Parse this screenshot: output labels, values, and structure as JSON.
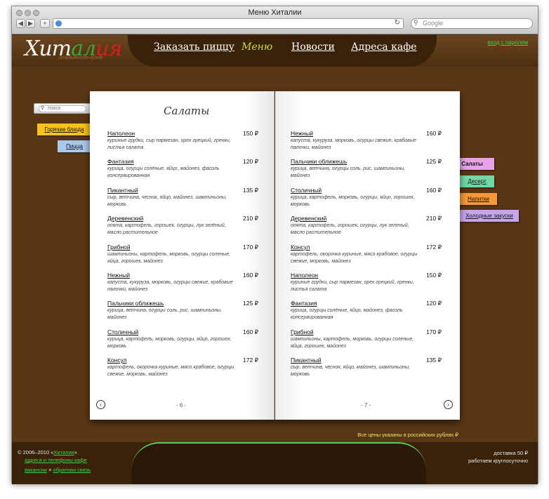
{
  "browser": {
    "title": "Меню Хиталии",
    "search_placeholder": "Google"
  },
  "header": {
    "logo": {
      "part1": "Хит",
      "part2": "ал",
      "part3": "ия"
    },
    "tagline": "итальянская кухня",
    "nav": [
      {
        "label": "Заказать пиццу"
      },
      {
        "label": "Меню"
      },
      {
        "label": "Новости"
      },
      {
        "label": "Адреса кафе"
      }
    ],
    "login": "вход с паролем"
  },
  "search": {
    "placeholder": "поиск"
  },
  "left_tabs": [
    {
      "label": "Горячие блюда",
      "color": "#f7c21c"
    },
    {
      "label": "Пицца",
      "color": "#a9c8ee"
    }
  ],
  "right_tabs": [
    {
      "label": "Салаты",
      "color": "#e6a3e8"
    },
    {
      "label": "Десерт",
      "color": "#6ed8a6"
    },
    {
      "label": "Напитки",
      "color": "#f59a3a"
    },
    {
      "label": "Холодные закуски",
      "color": "#c8a6ee"
    }
  ],
  "book": {
    "title": "Салаты",
    "left_page_number": "- 6 -",
    "right_page_number": "- 7 -",
    "left_items": [
      {
        "name": "Наполеон",
        "price": "150 ₽",
        "desc": "куриные грудки, сыр пармезан, орех грецкий, гренки, листья салата"
      },
      {
        "name": "Фантазия",
        "price": "120 ₽",
        "desc": "курица, огурцы солёные, яйцо, майонез, фасоль консервированная"
      },
      {
        "name": "Пикантный",
        "price": "135 ₽",
        "desc": "сыр, ветчина, чеснок, яйцо, майонез, шампиньоны, морковь"
      },
      {
        "name": "Деревенский",
        "price": "210 ₽",
        "desc": "опята, картофель, горошек, огурцы, лук зелёный, масло растительное"
      },
      {
        "name": "Грибной",
        "price": "170 ₽",
        "desc": "шампиньоны, картофель, морковь, огурцы соленые, яйца, горошек, майонез"
      },
      {
        "name": "Нежный",
        "price": "160 ₽",
        "desc": "капуста, кукуруза, морковь, огурцы свежие, крабовые палочки, майонез"
      },
      {
        "name": "Пальчики оближешь",
        "price": "125 ₽",
        "desc": "курица, ветчина, огурцы соль, рис, шампиньоны, майонез"
      },
      {
        "name": "Столичный",
        "price": "160 ₽",
        "desc": "курица, картофель, морковь, огурцы, яйцо, горошек, морковь"
      },
      {
        "name": "Консул",
        "price": "172 ₽",
        "desc": "картофель, окорочка куриные, мясо крабовое, огурцы свежие, морковь, майонез"
      }
    ],
    "right_items": [
      {
        "name": "Нежный",
        "price": "160 ₽",
        "desc": "капуста, кукуруза, морковь, огурцы свежие, крабовые палочки, майонез"
      },
      {
        "name": "Пальчики оближешь",
        "price": "125 ₽",
        "desc": "курица, ветчина, огурцы соль, рис, шампиньоны, майонез"
      },
      {
        "name": "Столичный",
        "price": "160 ₽",
        "desc": "курица, картофель, морковь, огурцы, яйцо, горошек, морковь"
      },
      {
        "name": "Деревенский",
        "price": "210 ₽",
        "desc": "опята, картофель, горошек, огурцы, лук зеленый, масло растительное"
      },
      {
        "name": "Консул",
        "price": "172 ₽",
        "desc": "картофель, окорочка куриные, мясо крабовое, огурцы свежие, морковь, майонез"
      },
      {
        "name": "Наполеон",
        "price": "150 ₽",
        "desc": "куриные грудки, сыр пармезан, орех грецкий, гренки, листья салата"
      },
      {
        "name": "Фантазия",
        "price": "120 ₽",
        "desc": "курица, огурцы солёные, яйцо, майонез, фасоль консервированная"
      },
      {
        "name": "Грибной",
        "price": "170 ₽",
        "desc": "шампиньоны, картофель, морковь, огурцы соленые, яйца, горошек, майонез"
      },
      {
        "name": "Пикантный",
        "price": "135 ₽",
        "desc": "сыр, ветчина, чеснок, яйцо, майонез, шампиньоны, морковь"
      }
    ]
  },
  "price_note": "Все цены указаны в российских рублях ₽",
  "footer": {
    "copyright_prefix": "© 2006–2010 «",
    "brand": "Хиталия",
    "copyright_suffix": "»",
    "addresses": "адреса и телефоны кафе",
    "vacancies": "вакансии",
    "separator": "×",
    "feedback": "обратная связь",
    "delivery": "доставка 50 ₽",
    "hours": "работаем круглосуточно"
  }
}
